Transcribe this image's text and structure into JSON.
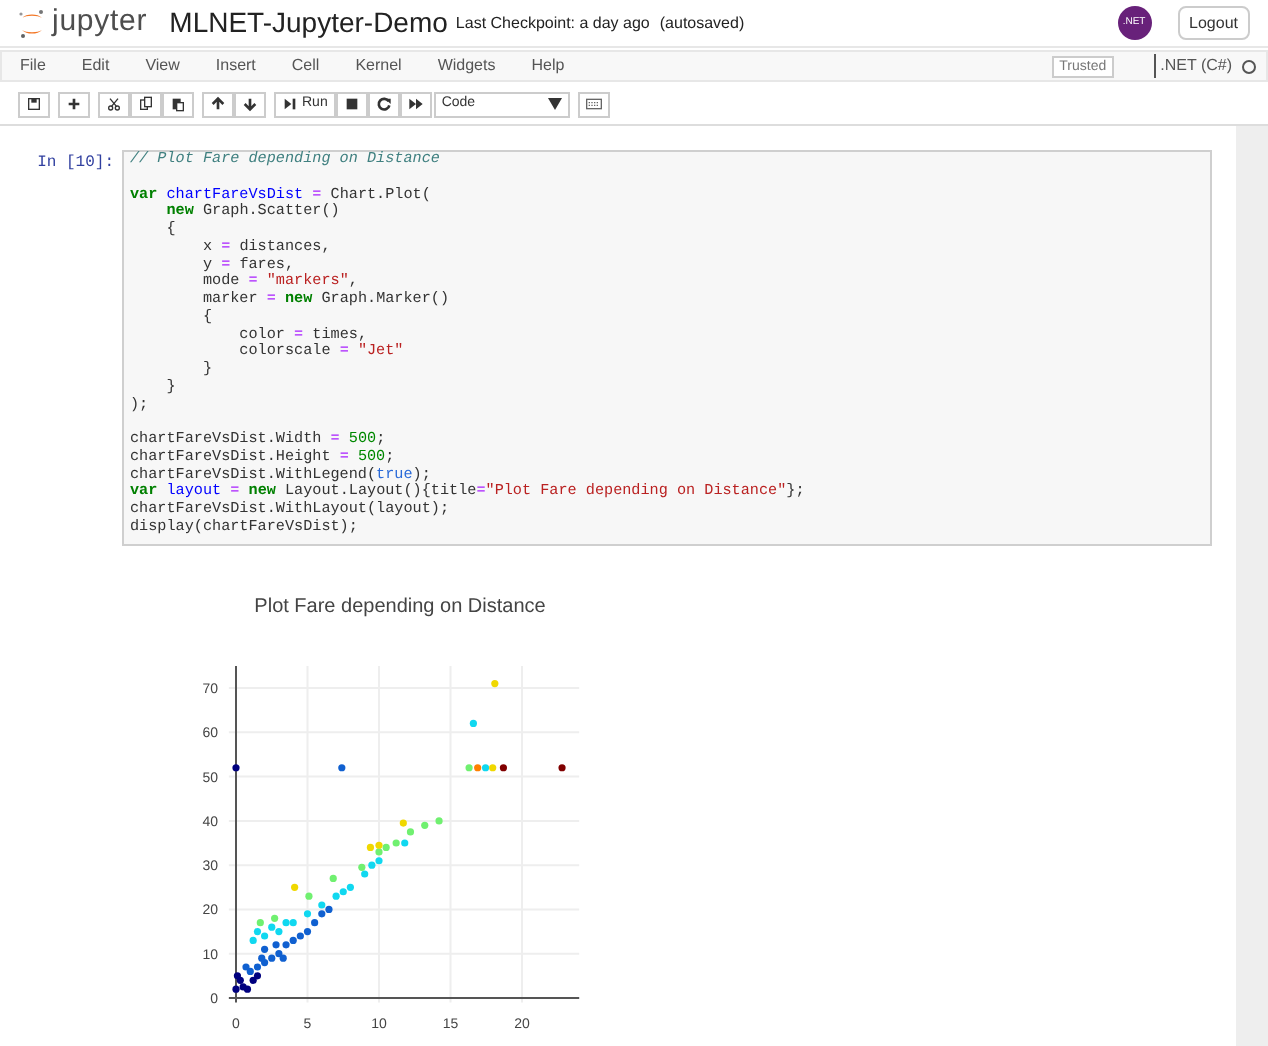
{
  "header": {
    "logo_text": "jupyter",
    "notebook_name": "MLNET-Jupyter-Demo",
    "checkpoint": "Last Checkpoint: a day ago",
    "autosave": "(autosaved)",
    "avatar_text": ".NET",
    "logout": "Logout"
  },
  "menu": [
    "File",
    "Edit",
    "View",
    "Insert",
    "Cell",
    "Kernel",
    "Widgets",
    "Help"
  ],
  "trusted": "Trusted",
  "kernel": ".NET (C#)",
  "kernel_busy": false,
  "toolbar": [
    {
      "kind": "save"
    },
    {
      "kind": "add"
    },
    {
      "kind": "cut"
    },
    {
      "kind": "copy"
    },
    {
      "kind": "paste"
    },
    {
      "kind": "up"
    },
    {
      "kind": "down"
    },
    {
      "kind": "run",
      "label": "Run"
    },
    {
      "kind": "stop"
    },
    {
      "kind": "restart"
    },
    {
      "kind": "fast-forward"
    },
    {
      "kind": "select",
      "label": "Code"
    },
    {
      "kind": "keyboard"
    }
  ],
  "cell": {
    "prompt": "In [10]:",
    "code": [
      {
        "tokens": [
          {
            "kind": "comment",
            "text": "// Plot Fare depending on Distance"
          }
        ]
      },
      {
        "gap_before": true,
        "tokens": [
          {
            "kind": "keyword",
            "text": "var"
          },
          {
            "kind": "def",
            "text": " chartFareVsDist"
          },
          {
            "kind": "op",
            "text": " ="
          },
          {
            "kind": "plain",
            "text": " Chart.Plot("
          }
        ]
      },
      {
        "tokens": [
          {
            "kind": "keyword",
            "text": "    new"
          },
          {
            "kind": "plain",
            "text": " Graph.Scatter()"
          }
        ]
      },
      {
        "tokens": [
          {
            "kind": "plain",
            "text": "    {"
          }
        ]
      },
      {
        "tokens": [
          {
            "kind": "plain",
            "text": "        x"
          },
          {
            "kind": "op",
            "text": " ="
          },
          {
            "kind": "plain",
            "text": " distances,"
          }
        ]
      },
      {
        "tokens": [
          {
            "kind": "plain",
            "text": "        y"
          },
          {
            "kind": "op",
            "text": " ="
          },
          {
            "kind": "plain",
            "text": " fares,"
          }
        ]
      },
      {
        "tokens": [
          {
            "kind": "plain",
            "text": "        mode"
          },
          {
            "kind": "op",
            "text": " ="
          },
          {
            "kind": "string",
            "text": " \"markers\""
          },
          {
            "kind": "plain",
            "text": ","
          }
        ]
      },
      {
        "tokens": [
          {
            "kind": "plain",
            "text": "        marker"
          },
          {
            "kind": "op",
            "text": " ="
          },
          {
            "kind": "keyword",
            "text": " new"
          },
          {
            "kind": "plain",
            "text": " Graph.Marker()"
          }
        ]
      },
      {
        "tokens": [
          {
            "kind": "plain",
            "text": "        {"
          }
        ]
      },
      {
        "tokens": [
          {
            "kind": "plain",
            "text": "            color"
          },
          {
            "kind": "op",
            "text": " ="
          },
          {
            "kind": "plain",
            "text": " times,"
          }
        ]
      },
      {
        "tokens": [
          {
            "kind": "plain",
            "text": "            colorscale"
          },
          {
            "kind": "op",
            "text": " ="
          },
          {
            "kind": "string",
            "text": " \"Jet\""
          }
        ]
      },
      {
        "tokens": [
          {
            "kind": "plain",
            "text": "        }"
          }
        ]
      },
      {
        "tokens": [
          {
            "kind": "plain",
            "text": "    }"
          }
        ]
      },
      {
        "tokens": [
          {
            "kind": "plain",
            "text": ");"
          }
        ]
      },
      {
        "gap_before": true,
        "tokens": [
          {
            "kind": "plain",
            "text": "chartFareVsDist.Width"
          },
          {
            "kind": "op",
            "text": " ="
          },
          {
            "kind": "number",
            "text": " 500"
          },
          {
            "kind": "plain",
            "text": ";"
          }
        ]
      },
      {
        "tokens": [
          {
            "kind": "plain",
            "text": "chartFareVsDist.Height"
          },
          {
            "kind": "op",
            "text": " ="
          },
          {
            "kind": "number",
            "text": " 500"
          },
          {
            "kind": "plain",
            "text": ";"
          }
        ]
      },
      {
        "tokens": [
          {
            "kind": "plain",
            "text": "chartFareVsDist.WithLegend("
          },
          {
            "kind": "atom",
            "text": "true"
          },
          {
            "kind": "plain",
            "text": ");"
          }
        ]
      },
      {
        "tokens": [
          {
            "kind": "keyword",
            "text": "var"
          },
          {
            "kind": "def",
            "text": " layout"
          },
          {
            "kind": "op",
            "text": " ="
          },
          {
            "kind": "keyword",
            "text": " new"
          },
          {
            "kind": "plain",
            "text": " Layout.Layout(){title"
          },
          {
            "kind": "op",
            "text": "="
          },
          {
            "kind": "string",
            "text": "\"Plot Fare depending on Distance\""
          },
          {
            "kind": "plain",
            "text": "};"
          }
        ]
      },
      {
        "tokens": [
          {
            "kind": "plain",
            "text": "chartFareVsDist.WithLayout(layout);"
          }
        ]
      },
      {
        "tokens": [
          {
            "kind": "plain",
            "text": "display(chartFareVsDist);"
          }
        ]
      }
    ]
  },
  "output": {
    "chart_data": {
      "type": "scatter",
      "grid": true,
      "title": "Plot Fare depending on Distance",
      "xlim": [
        -0.5,
        24
      ],
      "ylim": [
        -1,
        75
      ],
      "xticks": [
        0,
        5,
        10,
        15,
        20
      ],
      "yticks": [
        0,
        10,
        20,
        30,
        40,
        50,
        60,
        70
      ],
      "series": [
        {
          "color": "#00007f",
          "x": [
            0,
            0,
            0.5,
            0.3,
            0.8,
            1.2,
            1.5,
            0.1
          ],
          "values": [
            52,
            2,
            2.5,
            4,
            2,
            4,
            5,
            5
          ]
        },
        {
          "color": "#1060d0",
          "x": [
            7.4,
            1,
            1.5,
            2,
            2.5,
            3,
            2,
            3.5,
            4,
            4.5,
            5,
            5.5,
            6,
            6.5,
            1.8,
            2.8,
            0.7,
            3.3
          ],
          "values": [
            52,
            6,
            7,
            8,
            9,
            10,
            11,
            12,
            13,
            14,
            15,
            17,
            19,
            20,
            9,
            12,
            7,
            9
          ]
        },
        {
          "color": "#10d8f0",
          "x": [
            16.6,
            17.45,
            1.2,
            2,
            3,
            4,
            5,
            6,
            7,
            8,
            9,
            10,
            11.8,
            1.5,
            3.5,
            2.5,
            7.5,
            9.5
          ],
          "values": [
            62,
            52,
            13,
            14,
            15,
            17,
            19,
            21,
            23,
            25,
            28,
            31,
            35,
            15,
            17,
            16,
            24,
            30
          ]
        },
        {
          "color": "#70f070",
          "x": [
            1.7,
            2.7,
            5.1,
            6.8,
            8.8,
            10,
            10.5,
            12.2,
            13.2,
            14.2,
            16.3,
            11.2
          ],
          "values": [
            17,
            18,
            23,
            27,
            29.5,
            33,
            34,
            37.5,
            39,
            40,
            52,
            35
          ]
        },
        {
          "color": "#f0d800",
          "x": [
            4.1,
            9.4,
            10,
            11.7,
            18.1,
            17.95
          ],
          "values": [
            25,
            34,
            34.5,
            39.5,
            71,
            52
          ]
        },
        {
          "color": "#ff8000",
          "x": [
            16.9
          ],
          "values": [
            52
          ]
        },
        {
          "color": "#800000",
          "x": [
            18.7,
            22.8
          ],
          "values": [
            52,
            52
          ]
        }
      ]
    }
  }
}
